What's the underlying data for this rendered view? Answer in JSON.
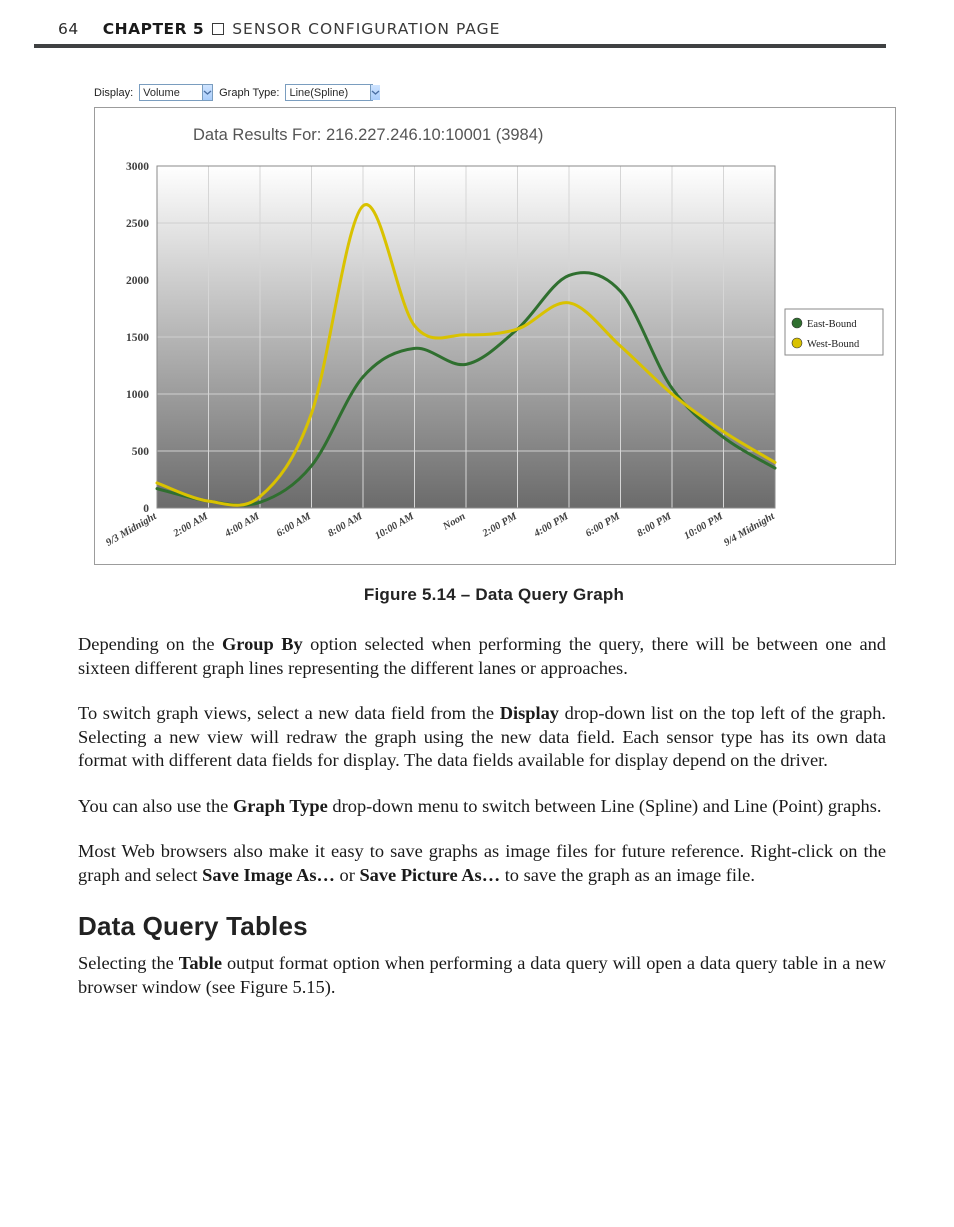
{
  "header": {
    "page_number": "64",
    "chapter_label": "CHAPTER 5",
    "page_title": "SENSOR CONFIGURATION PAGE"
  },
  "controls": {
    "display_label": "Display:",
    "display_value": "Volume",
    "graph_type_label": "Graph Type:",
    "graph_type_value": "Line(Spline)"
  },
  "figure": {
    "caption": "Figure 5.14 – Data Query Graph"
  },
  "chart_data": {
    "type": "line",
    "title": "Data Results For: 216.227.246.10:10001 (3984)",
    "xlabel": "",
    "ylabel": "",
    "ylim": [
      0,
      3000
    ],
    "y_ticks": [
      0,
      500,
      1000,
      1500,
      2000,
      2500,
      3000
    ],
    "categories": [
      "9/3 Midnight",
      "2:00 AM",
      "4:00 AM",
      "6:00 AM",
      "8:00 AM",
      "10:00 AM",
      "Noon",
      "2:00 PM",
      "4:00 PM",
      "6:00 PM",
      "8:00 PM",
      "10:00 PM",
      "9/4 Midnight"
    ],
    "legend": {
      "position": "right",
      "entries": [
        {
          "name": "East-Bound",
          "color": "#2f6f2f"
        },
        {
          "name": "West-Bound",
          "color": "#d9c200"
        }
      ]
    },
    "series": [
      {
        "name": "East-Bound",
        "color": "#2f6f2f",
        "values": [
          170,
          60,
          50,
          370,
          1150,
          1400,
          1260,
          1570,
          2040,
          1900,
          1050,
          620,
          350
        ]
      },
      {
        "name": "West-Bound",
        "color": "#d9c200",
        "values": [
          220,
          60,
          100,
          830,
          2650,
          1600,
          1520,
          1570,
          1800,
          1420,
          1000,
          670,
          400
        ]
      }
    ]
  },
  "body": {
    "p1a": "Depending on the ",
    "p1_bold": "Group By",
    "p1b": " option selected when performing the query, there will be between one and sixteen different graph lines representing the different lanes or approaches.",
    "p2a": "To switch graph views, select a new data field from the ",
    "p2_bold": "Display",
    "p2b": " drop-down list on the top left of the graph. Selecting a new view will redraw the graph using the new data field. Each sensor type has its own data format with different data fields for display. The data fields available for display depend on the driver.",
    "p3a": "You can also use the ",
    "p3_bold": "Graph Type",
    "p3b": " drop-down menu to switch between Line (Spline) and Line (Point) graphs.",
    "p4a": "Most Web browsers also make it easy to save graphs as image files for future reference. Right-click on the graph and select ",
    "p4_bold1": "Save Image As…",
    "p4_mid": " or ",
    "p4_bold2": "Save Picture As…",
    "p4b": " to save the graph as an image file."
  },
  "section": {
    "heading": "Data Query Tables",
    "p5a": "Selecting the ",
    "p5_bold": "Table",
    "p5b": " output format option when performing a data query will open a data query table in a new browser window (see Figure 5.15)."
  }
}
